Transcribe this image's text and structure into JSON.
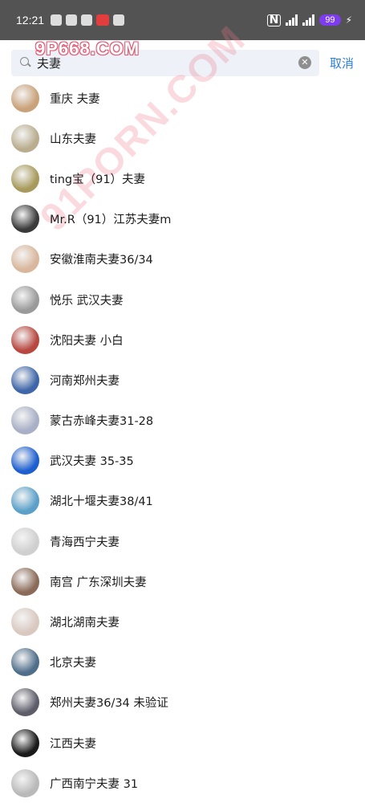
{
  "status_bar": {
    "time": "12:21",
    "battery": "99",
    "icons": [
      "wechat-icon",
      "tiktok-icon",
      "app-icon",
      "red-app-icon",
      "photo-app-icon"
    ]
  },
  "watermark": {
    "text": "9P668.COM",
    "diagonal_text": "91PORN.COM"
  },
  "search": {
    "value": "夫妻",
    "cancel_label": "取消"
  },
  "results": [
    {
      "name": "重庆 夫妻",
      "avatar_color": "#c9a27a"
    },
    {
      "name": "山东夫妻",
      "avatar_color": "#b9ad8e"
    },
    {
      "name": "ting宝（91）夫妻",
      "avatar_color": "#a89a5c"
    },
    {
      "name": "Mr.R（91）江苏夫妻m",
      "avatar_color": "#3a3a3a"
    },
    {
      "name": "安徽淮南夫妻36/34",
      "avatar_color": "#d8b79c"
    },
    {
      "name": "悦乐  武汉夫妻",
      "avatar_color": "#9a9a9a"
    },
    {
      "name": "沈阳夫妻 小白",
      "avatar_color": "#b7473f"
    },
    {
      "name": "河南郑州夫妻",
      "avatar_color": "#3e66a8"
    },
    {
      "name": "蒙古赤峰夫妻31-28",
      "avatar_color": "#a8afc6"
    },
    {
      "name": "武汉夫妻 35-35",
      "avatar_color": "#1d5fcf"
    },
    {
      "name": "湖北十堰夫妻38/41",
      "avatar_color": "#5aa0c8"
    },
    {
      "name": "青海西宁夫妻",
      "avatar_color": "#cfcfcf"
    },
    {
      "name": "南宫  广东深圳夫妻",
      "avatar_color": "#8a6a58"
    },
    {
      "name": "湖北湖南夫妻",
      "avatar_color": "#d9c8c0"
    },
    {
      "name": "北京夫妻",
      "avatar_color": "#4f6e8a"
    },
    {
      "name": "郑州夫妻36/34  未验证",
      "avatar_color": "#5d5d6a"
    },
    {
      "name": "江西夫妻",
      "avatar_color": "#1a1a1a"
    },
    {
      "name": "广西南宁夫妻 31",
      "avatar_color": "#b9b9b9"
    }
  ]
}
